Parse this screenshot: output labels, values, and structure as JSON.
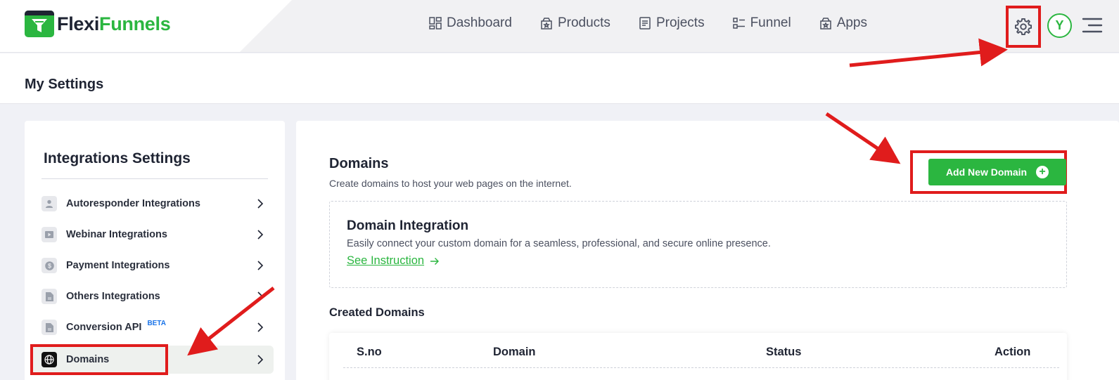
{
  "app": {
    "logo_part1": "Flexi",
    "logo_part2": "Funnels"
  },
  "nav": {
    "items": [
      {
        "label": "Dashboard",
        "icon": "dashboard-icon"
      },
      {
        "label": "Products",
        "icon": "products-icon"
      },
      {
        "label": "Projects",
        "icon": "projects-icon"
      },
      {
        "label": "Funnel",
        "icon": "funnel-icon"
      },
      {
        "label": "Apps",
        "icon": "apps-icon"
      }
    ],
    "avatar_initial": "Y"
  },
  "page": {
    "title": "My Settings"
  },
  "sidebar": {
    "heading": "Integrations Settings",
    "items": [
      {
        "label": "Autoresponder Integrations",
        "icon": "user-icon"
      },
      {
        "label": "Webinar Integrations",
        "icon": "video-icon"
      },
      {
        "label": "Payment Integrations",
        "icon": "dollar-icon"
      },
      {
        "label": "Others Integrations",
        "icon": "document-icon"
      },
      {
        "label": "Conversion API",
        "icon": "document-icon",
        "badge": "BETA"
      },
      {
        "label": "Domains",
        "icon": "globe-icon",
        "active": true
      }
    ]
  },
  "main": {
    "title": "Domains",
    "subtitle": "Create domains to host your web pages on the internet.",
    "add_button": "Add New Domain",
    "integration": {
      "title": "Domain Integration",
      "description": "Easily connect your custom domain for a seamless, professional, and secure online presence.",
      "link": "See Instruction"
    },
    "created_heading": "Created Domains",
    "table_headers": [
      "S.no",
      "Domain",
      "Status",
      "Action"
    ]
  },
  "colors": {
    "brand_green": "#2bb640",
    "annotation_red": "#e01c1c",
    "text_dark": "#1f2433"
  }
}
